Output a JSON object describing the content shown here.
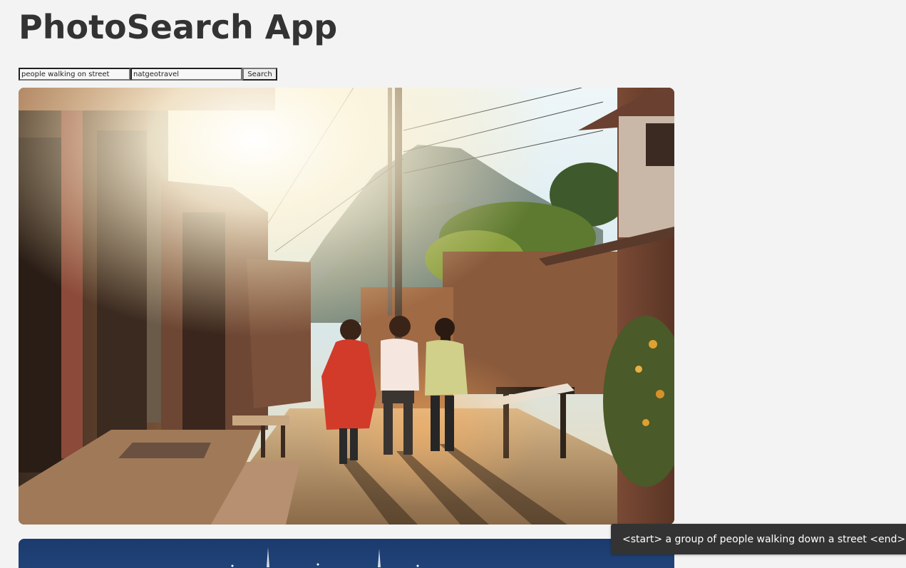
{
  "app": {
    "title": "PhotoSearch App"
  },
  "search": {
    "query_value": "people walking on street",
    "user_value": "natgeotravel",
    "button_label": "Search"
  },
  "results": [
    {
      "caption": "<start> a group of people walking down a street <end>"
    }
  ],
  "tooltip": {
    "text": "<start> a group of people walking down a street <end>"
  }
}
